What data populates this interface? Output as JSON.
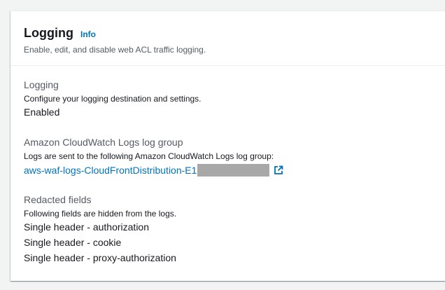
{
  "header": {
    "title": "Logging",
    "info_label": "Info",
    "description": "Enable, edit, and disable web ACL traffic logging."
  },
  "logging": {
    "label": "Logging",
    "description": "Configure your logging destination and settings.",
    "value": "Enabled"
  },
  "log_group": {
    "label": "Amazon CloudWatch Logs log group",
    "description": "Logs are sent to the following Amazon CloudWatch Logs log group:",
    "link_text": "aws-waf-logs-CloudFrontDistribution-E1"
  },
  "redacted_fields": {
    "label": "Redacted fields",
    "description": "Following fields are hidden from the logs.",
    "items": [
      "Single header - authorization",
      "Single header - cookie",
      "Single header - proxy-authorization"
    ]
  },
  "colors": {
    "link": "#0073bb",
    "redaction": "#a8a8a8"
  },
  "icons": {
    "external_link": "external-link-icon"
  }
}
